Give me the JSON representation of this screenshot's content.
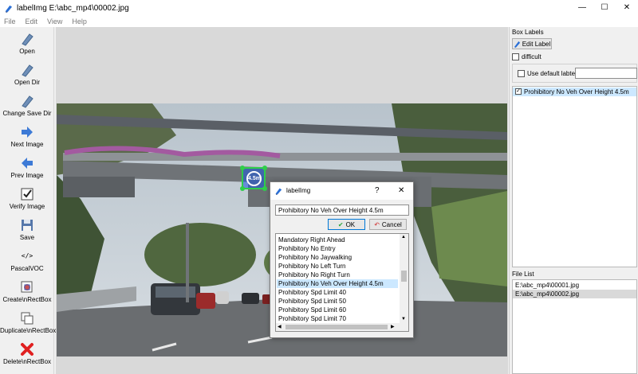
{
  "window": {
    "title": "labelImg E:\\abc_mp4\\00002.jpg",
    "minimize_glyph": "—",
    "maximize_glyph": "☐",
    "close_glyph": "✕"
  },
  "menu": [
    "File",
    "Edit",
    "View",
    "Help"
  ],
  "toolbar": [
    {
      "label": "Open",
      "icon": "open-icon"
    },
    {
      "label": "Open Dir",
      "icon": "open-dir-icon"
    },
    {
      "label": "Change Save Dir",
      "icon": "change-save-dir-icon"
    },
    {
      "label": "Next Image",
      "icon": "next-arrow-icon"
    },
    {
      "label": "Prev Image",
      "icon": "prev-arrow-icon"
    },
    {
      "label": "Verify Image",
      "icon": "verify-icon"
    },
    {
      "label": "Save",
      "icon": "floppy-icon"
    },
    {
      "label": "PascalVOC",
      "icon": "format-code-icon",
      "glyph": "</>"
    },
    {
      "label": "Create\\nRectBox",
      "icon": "create-rectbox-icon"
    },
    {
      "label": "Duplicate\\nRectBox",
      "icon": "duplicate-icon"
    },
    {
      "label": "Delete\\nRectBox",
      "icon": "delete-icon"
    }
  ],
  "canvas": {
    "sign_text": "4.5m"
  },
  "box_labels": {
    "title": "Box Labels",
    "edit_label_button": "Edit Label",
    "difficult_label": "difficult",
    "difficult_checked": false,
    "use_default_label": "Use default labtel",
    "use_default_checked": false,
    "default_label_value": "",
    "items": [
      {
        "label": "Prohibitory No Veh Over Height 4.5m",
        "checked": true
      }
    ]
  },
  "file_list": {
    "title": "File List",
    "files": [
      "E:\\abc_mp4\\00001.jpg",
      "E:\\abc_mp4\\00002.jpg"
    ],
    "selected_index": 1
  },
  "dialog": {
    "title": "labelImg",
    "help_glyph": "?",
    "close_glyph": "✕",
    "input_value": "Prohibitory No Veh Over Height 4.5m",
    "ok_label": "OK",
    "cancel_label": "Cancel",
    "options": [
      "Mandatory Right Ahead",
      "Prohibitory No Entry",
      "Prohibitory No Jaywalking",
      "Prohibitory No Left Turn",
      "Prohibitory No Right Turn",
      "Prohibitory No Veh Over Height 4.5m",
      "Prohibitory Spd Limit 40",
      "Prohibitory Spd Limit 50",
      "Prohibitory Spd Limit 60",
      "Prohibitory Spd Limit 70"
    ],
    "selected_index": 5
  },
  "colors": {
    "accent_blue": "#0078d7",
    "bbox_green": "#2fce4b",
    "selection_blue": "#cce8ff",
    "delete_red": "#e02020"
  }
}
